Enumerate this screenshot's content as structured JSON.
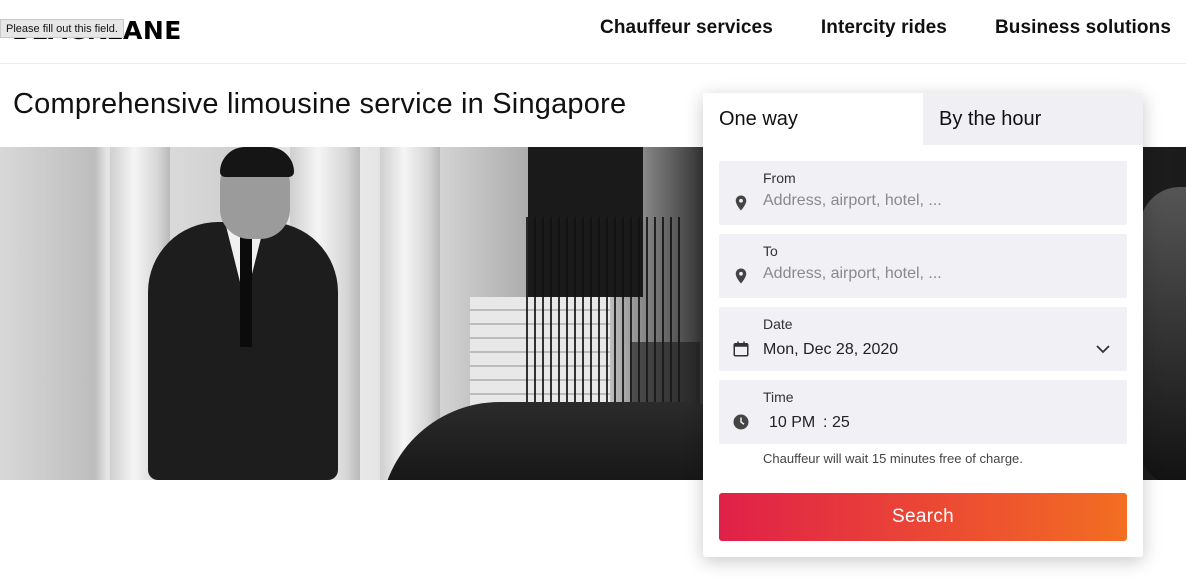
{
  "header": {
    "logo": "BLACKLANE",
    "tooltip": "Please fill out this field.",
    "nav": [
      {
        "label": "Chauffeur services"
      },
      {
        "label": "Intercity rides"
      },
      {
        "label": "Business solutions"
      }
    ]
  },
  "main": {
    "title": "Comprehensive limousine service in Singapore"
  },
  "booking": {
    "tabs": [
      {
        "label": "One way",
        "active": true
      },
      {
        "label": "By the hour",
        "active": false
      }
    ],
    "from": {
      "label": "From",
      "placeholder": "Address, airport, hotel, ...",
      "icon": "location-pin-icon"
    },
    "to": {
      "label": "To",
      "placeholder": "Address, airport, hotel, ...",
      "icon": "location-pin-icon"
    },
    "date": {
      "label": "Date",
      "value": "Mon, Dec 28, 2020",
      "icon": "calendar-icon"
    },
    "time": {
      "label": "Time",
      "hour": "10 PM",
      "separator": ":",
      "minute": "25",
      "icon": "clock-icon"
    },
    "note": "Chauffeur will wait 15 minutes free of charge.",
    "search_label": "Search",
    "accent_start": "#e02049",
    "accent_end": "#f26e22"
  }
}
